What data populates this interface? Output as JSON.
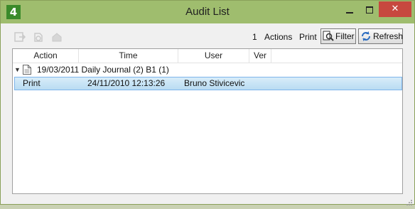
{
  "window": {
    "title": "Audit List",
    "app_icon_text": "4",
    "close_glyph": "✕"
  },
  "toolbar": {
    "count": "1",
    "actions_label": "Actions",
    "print_label": "Print",
    "filter_label": "Filter",
    "refresh_label": "Refresh"
  },
  "list": {
    "columns": [
      "Action",
      "Time",
      "User",
      "Ver"
    ],
    "groups": [
      {
        "label": "19/03/2011 Daily Journal (2) B1 (1)",
        "rows": [
          {
            "action": "Print",
            "time": "24/11/2010 12:13:26",
            "user": "Bruno Stivicevic",
            "ver": ""
          }
        ]
      }
    ]
  },
  "colors": {
    "titlebar": "#9fbd6e",
    "close": "#c7483f",
    "selection": "#b9dcf2"
  }
}
